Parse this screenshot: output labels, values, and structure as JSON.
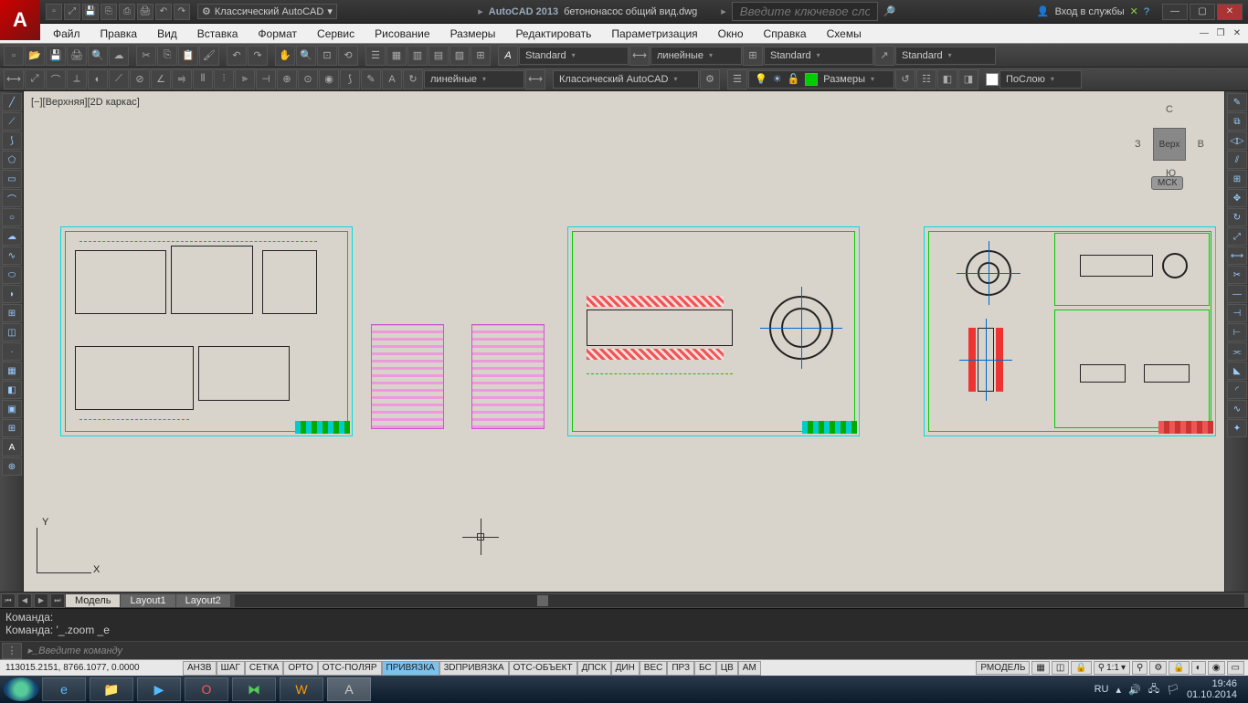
{
  "title": {
    "app": "AutoCAD 2013",
    "file": "бетононасос общий вид.dwg",
    "workspace": "Классический AutoCAD",
    "search_placeholder": "Введите ключевое слово/фразу",
    "signin": "Вход в службы"
  },
  "menu": {
    "items": [
      "Файл",
      "Правка",
      "Вид",
      "Вставка",
      "Формат",
      "Сервис",
      "Рисование",
      "Размеры",
      "Редактировать",
      "Параметризация",
      "Окно",
      "Справка",
      "Схемы"
    ]
  },
  "toolbars": {
    "style_text": "Standard",
    "dim_style": "линейные",
    "table_style": "Standard",
    "mleader_style": "Standard",
    "dim_style2": "линейные",
    "workspace2": "Классический AutoCAD",
    "layer_group": "Размеры",
    "color": "ПоСлою"
  },
  "viewport": {
    "label": "[−][Верхняя][2D каркас]",
    "cube_face": "Верх",
    "compass": {
      "n": "С",
      "s": "Ю",
      "e": "В",
      "w": "З"
    },
    "wcs": "МСК"
  },
  "tabs": {
    "model": "Модель",
    "layout1": "Layout1",
    "layout2": "Layout2"
  },
  "command": {
    "label": "Команда:",
    "last": "Команда: '_.zoom _e",
    "placeholder": "Введите команду"
  },
  "status": {
    "coords": "113015.2151, 8766.1077, 0.0000",
    "toggles": [
      "АНЗВ",
      "ШАГ",
      "СЕТКА",
      "ОРТО",
      "ОТС-ПОЛЯР",
      "ПРИВЯЗКА",
      "3DПРИВЯЗКА",
      "ОТС-ОБЪЕКТ",
      "ДПСК",
      "ДИН",
      "ВЕС",
      "ПРЗ",
      "БС",
      "ЦВ",
      "АМ"
    ],
    "toggles_on": [
      5
    ],
    "model_btn": "РМОДЕЛЬ",
    "scale": "1:1"
  },
  "tray": {
    "lang": "RU",
    "time": "19:46",
    "date": "01.10.2014"
  }
}
